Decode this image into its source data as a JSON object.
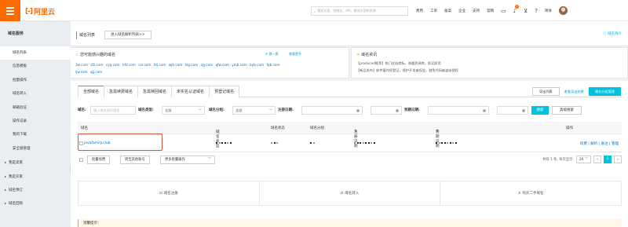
{
  "topbar": {
    "logo_text": "阿里云",
    "search_placeholder": "搜索文档、控制台、API、解决方案和资源",
    "nav": [
      "费用",
      "工单",
      "备案",
      "企业",
      "支持",
      "官网"
    ],
    "language": "简体",
    "notification_count": "1",
    "accent": "#ff6a00"
  },
  "sidebar": {
    "title": "域名服务",
    "items": [
      "域名列表",
      "信息模板",
      "批量操作",
      "域名转入",
      "邮箱验证",
      "操作记录",
      "我的下载",
      "安全锁管理"
    ],
    "groups": [
      "我是卖家",
      "我是买家",
      "域名预订",
      "域名回购"
    ]
  },
  "header": {
    "title": "域名列表",
    "parse_button": "进入域名解析列表>>",
    "help_link": "域名简介"
  },
  "recommend": {
    "title": "您可能感兴趣的域名",
    "refresh": "换一换",
    "more": "查看更多",
    "domains": [
      "3w.com",
      "zfz.com",
      "cyq.com",
      "hfd.com",
      "czr.com",
      "htj.com",
      "wjb.com",
      "klg.com",
      "zjy.com",
      "qfw.com",
      "ymb.com",
      "byb.com",
      "fqb.com",
      "ljw.com",
      "qjj.com"
    ]
  },
  "news": {
    "title": "域名资讯",
    "lines": [
      "【produced推荐】热门优选商标，海量资源库，即买即用",
      "【新品发布】软件著作权登记，保护开发者权益，避免代码被盗或侵权"
    ]
  },
  "tabs": [
    "全部域名",
    "急需续费域名",
    "急需赎回域名",
    "未实名认证域名",
    "预登记域名"
  ],
  "tools": {
    "export_list": "导出列表",
    "view_export": "查看导出结果",
    "group_manage": "域名分组管理"
  },
  "filters": {
    "domain_label": "域名:",
    "domain_placeholder": "输入域名进行搜索",
    "type_label": "域名类型:",
    "type_value": "全部",
    "group_label": "域名分组:",
    "group_value": "全部",
    "reg_label": "注册日期:",
    "exp_label": "到期日期:",
    "search_btn": "搜索",
    "advanced_btn": "高级搜索"
  },
  "table": {
    "headers": [
      "域名",
      "域名类型",
      "域名状态",
      "域名分组",
      "注册日期",
      "到期日期",
      "操作"
    ],
    "rows": [
      {
        "domain": "javafamily.club",
        "ops": "续费 | 解析 | 备注 | 管理"
      }
    ]
  },
  "bulk": {
    "renew": "批量续费",
    "transfer": "转至其他账号",
    "more": "更多批量操作",
    "total": "共有 1 条, 每页显示:",
    "page_size": "20",
    "current_page": "1",
    "prev": "<",
    "next": ">"
  },
  "actions": [
    "域名注册",
    "域名转入",
    "购买二手域名"
  ],
  "tip": "温馨提示："
}
